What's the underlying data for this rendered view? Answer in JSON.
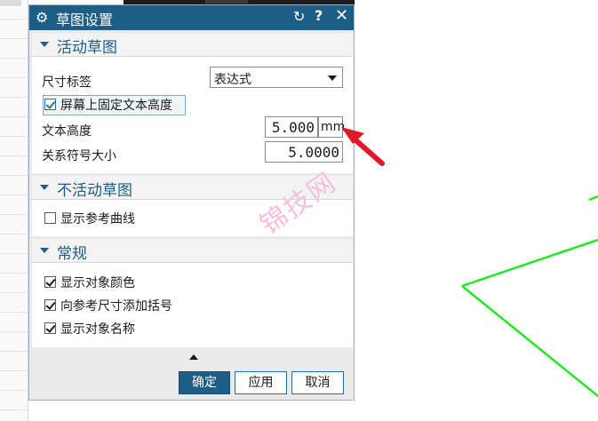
{
  "dialog": {
    "title": "草图设置",
    "sections": {
      "active": {
        "title": "活动草图"
      },
      "inactive": {
        "title": "不活动草图"
      },
      "general": {
        "title": "常规"
      }
    },
    "dimension_label": {
      "label": "尺寸标签",
      "selected": "表达式"
    },
    "fix_text_height": {
      "label": "屏幕上固定文本高度",
      "checked": true
    },
    "text_height": {
      "label": "文本高度",
      "value": "5.000",
      "unit": "mm"
    },
    "symbol_size": {
      "label": "关系符号大小",
      "value": "5.0000"
    },
    "show_ref_curves": {
      "label": "显示参考曲线",
      "checked": false
    },
    "show_object_color": {
      "label": "显示对象颜色",
      "checked": true
    },
    "add_parens": {
      "label": "向参考尺寸添加括号",
      "checked": true
    },
    "show_object_name": {
      "label": "显示对象名称",
      "checked": true
    },
    "buttons": {
      "ok": "确定",
      "apply": "应用",
      "cancel": "取消"
    }
  },
  "watermark": "锦技网",
  "colors": {
    "titlebar": "#1d5e86",
    "annotation_arrow": "#e0192a",
    "sketch_lines": "#22e622"
  }
}
